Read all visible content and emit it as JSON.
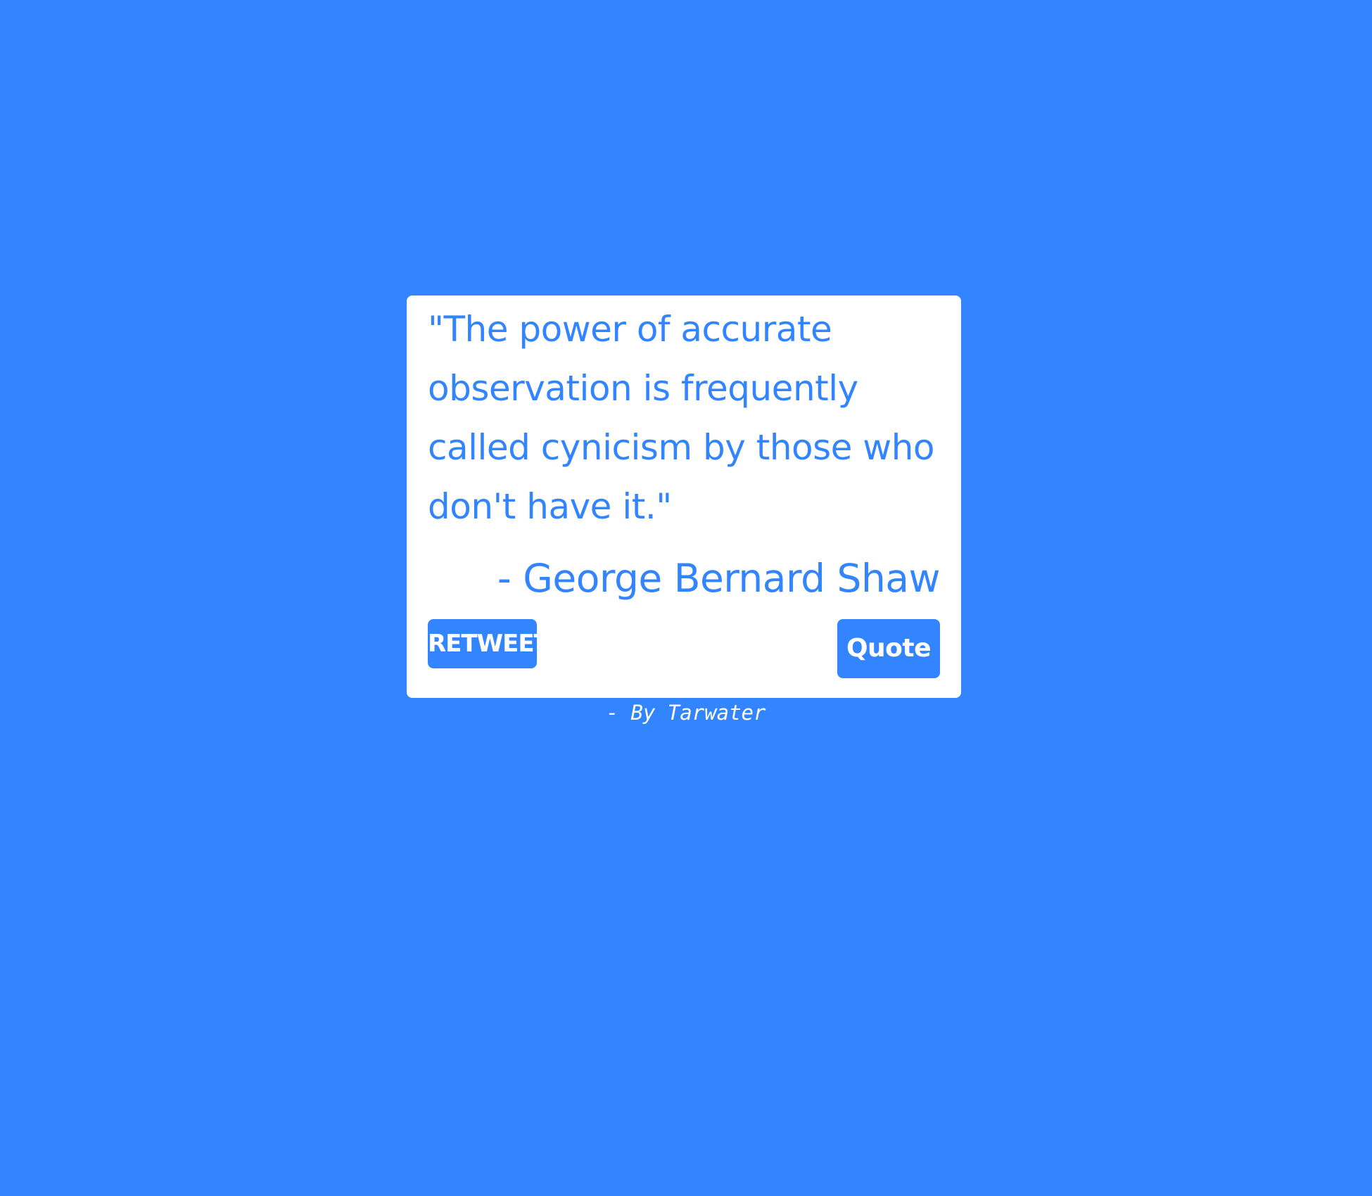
{
  "quote": {
    "text": "\"The power of accurate observation is frequently called cynicism by those who don't have it.\"",
    "author": "- George Bernard Shaw"
  },
  "actions": {
    "retweet_label": "RETWEET",
    "quote_label": "Quote"
  },
  "footer": {
    "credit": "- By Tarwater"
  },
  "colors": {
    "background": "#3385ff",
    "card": "#ffffff",
    "accent": "#3385ff"
  }
}
